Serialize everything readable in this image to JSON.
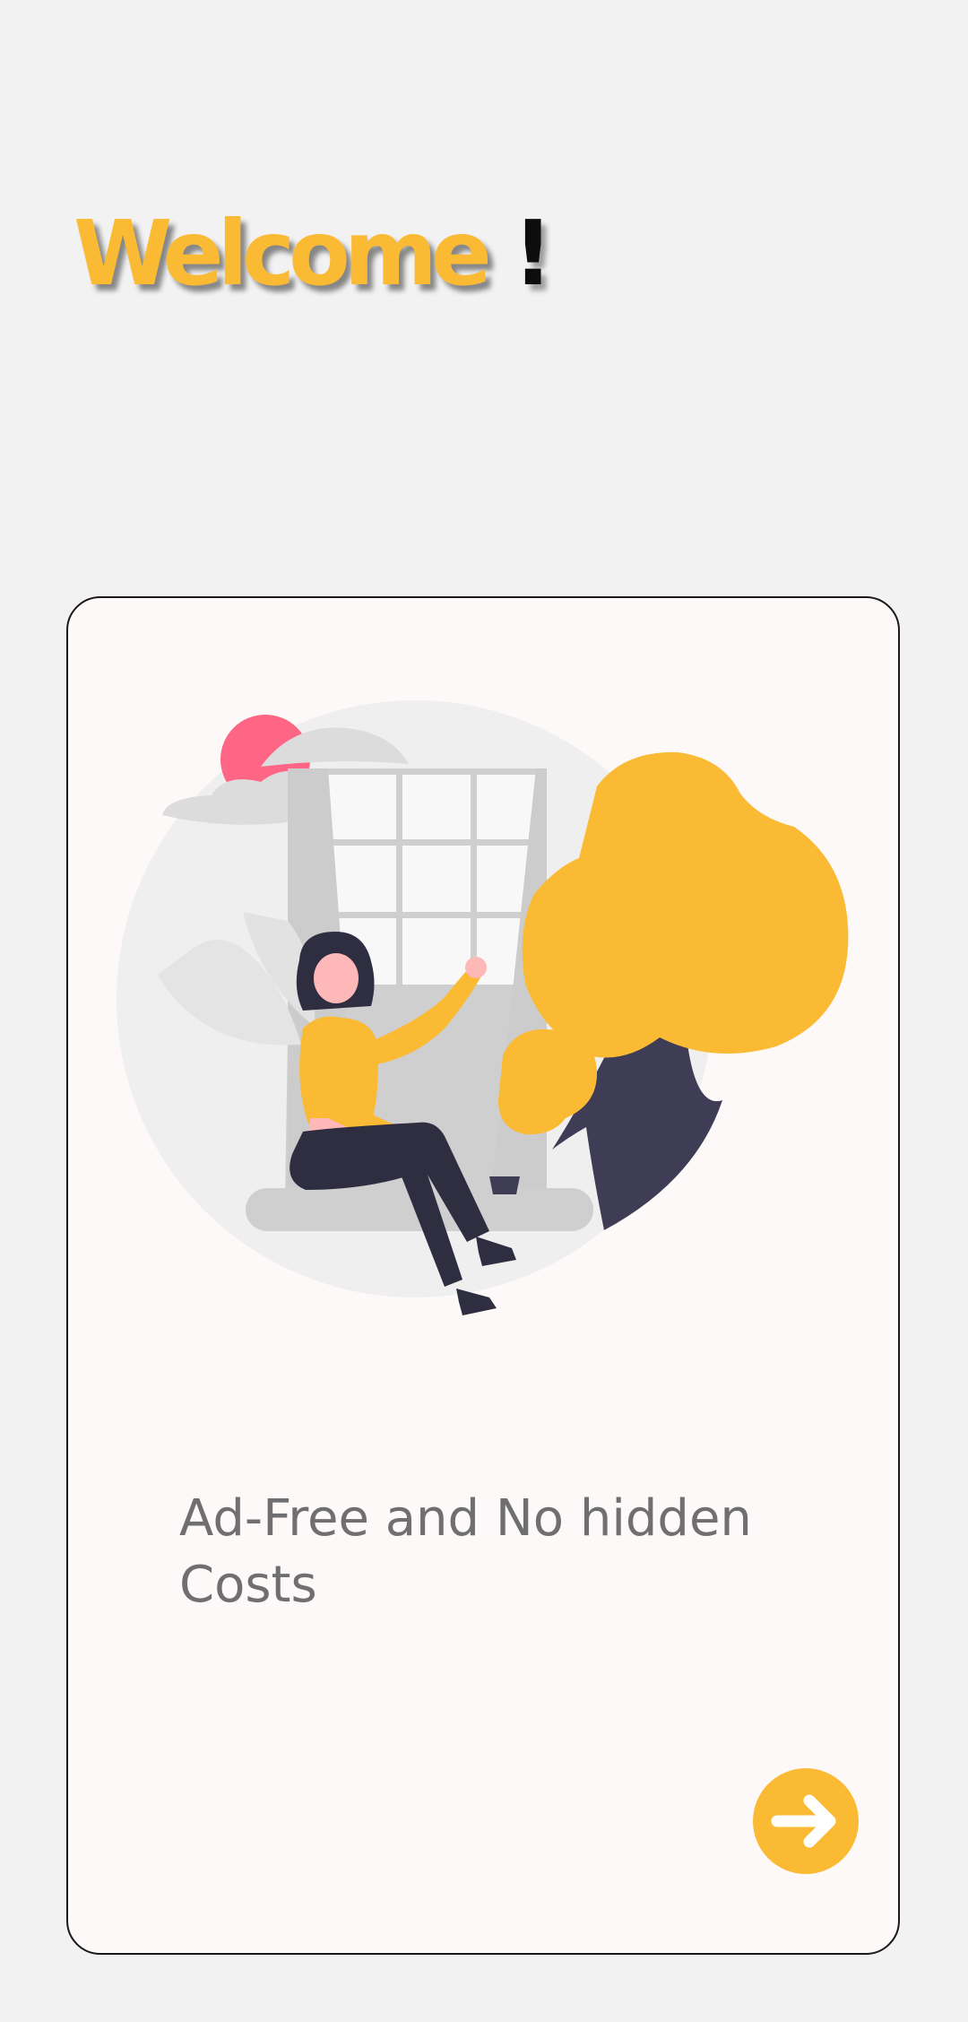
{
  "header": {
    "title_word": "Welcome",
    "title_mark": "!"
  },
  "card": {
    "text": "Ad-Free and No hidden Costs",
    "next_button": {
      "icon": "arrow-right-icon",
      "aria_label": "Next"
    }
  },
  "colors": {
    "background": "#f2f2f2",
    "card": "#fcf9f8",
    "accent": "#fbba34",
    "text": "#6f6e70",
    "dark": "#3f3d56",
    "pink": "#ff6584"
  }
}
